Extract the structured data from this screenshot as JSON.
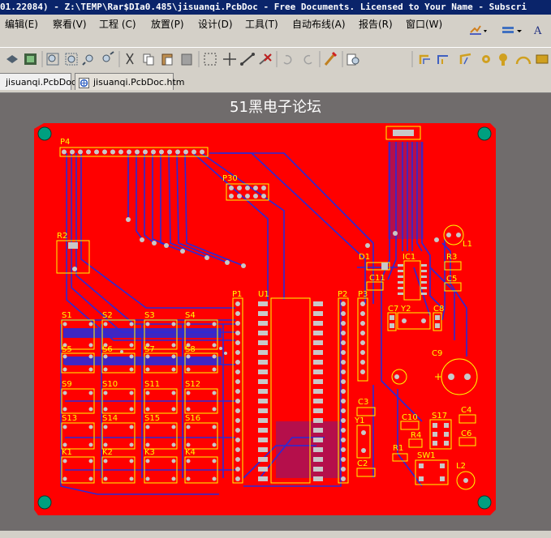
{
  "window": {
    "title": "01.22084) - Z:\\TEMP\\Rar$DIa0.485\\jisuanqi.PcbDoc - Free Documents. Licensed to Your Name - Subscri"
  },
  "menu": [
    "编辑(E)",
    "察看(V)",
    "工程 (C)",
    "放置(P)",
    "设计(D)",
    "工具(T)",
    "自动布线(A)",
    "报告(R)",
    "窗口(W)"
  ],
  "tabs": [
    {
      "label": "jisuanqi.PcbDoc",
      "active": true,
      "icon": "pcb-doc-icon"
    },
    {
      "label": "jisuanqi.PcbDoc.htm",
      "active": false,
      "icon": "html-doc-icon"
    }
  ],
  "board": {
    "title": "51黑电子论坛",
    "colors": {
      "board": "#ff0000",
      "trace": "#2a2ad8",
      "silk": "#ffff00",
      "pad": "#c8c8c8",
      "hole": "#00a080",
      "canvas": "#706c6c"
    },
    "labels": [
      "P4",
      "P30",
      "R2",
      "D1",
      "IC1",
      "R3",
      "L1",
      "C11",
      "C5",
      "P1",
      "U1",
      "P2",
      "P3",
      "C7",
      "Y2",
      "C8",
      "S1",
      "S2",
      "S3",
      "S4",
      "S5",
      "S6",
      "S7",
      "S8",
      "C9",
      "S9",
      "S10",
      "S11",
      "S12",
      "C3",
      "S13",
      "S14",
      "S15",
      "S16",
      "Y1",
      "C10",
      "S17",
      "C4",
      "R4",
      "C6",
      "K1",
      "K2",
      "K3",
      "K4",
      "R1",
      "SW1",
      "C2",
      "L2"
    ]
  }
}
